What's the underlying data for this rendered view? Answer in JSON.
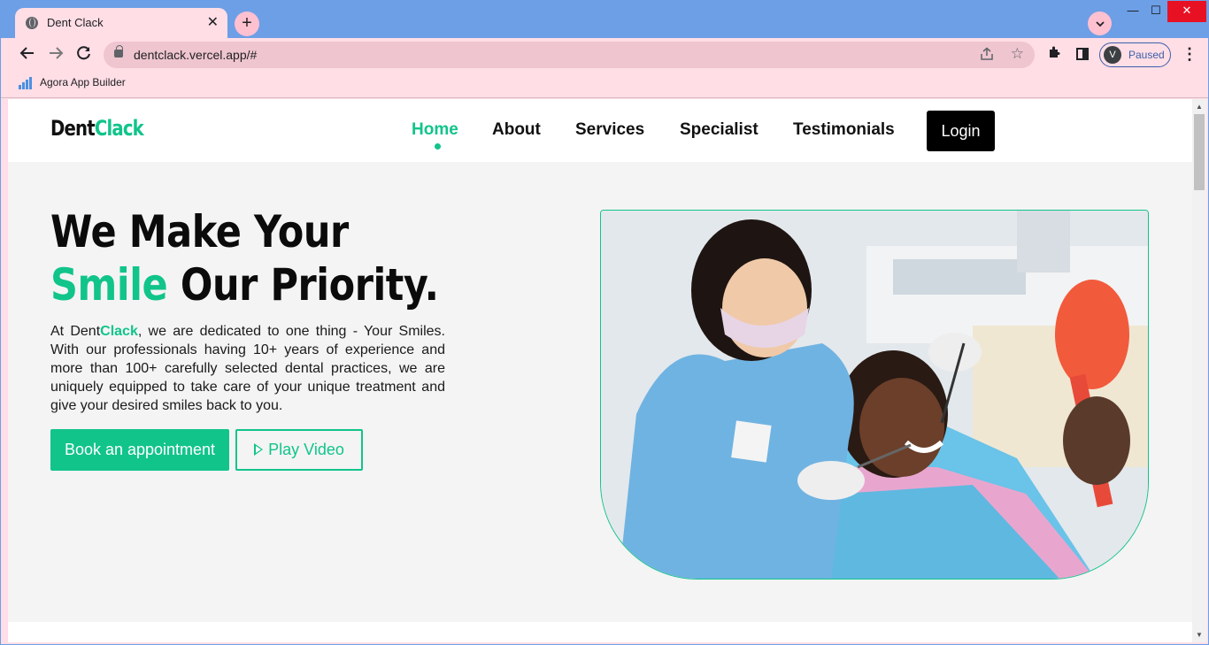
{
  "browser": {
    "tab_title": "Dent Clack",
    "tab_close": "✕",
    "new_tab": "+",
    "url": "dentclack.vercel.app/#",
    "profile_initial": "V",
    "profile_status": "Paused",
    "bookmark_label": "Agora App Builder",
    "window_min": "—",
    "window_max": "☐",
    "window_close": "✕"
  },
  "site": {
    "logo_part1": "Dent",
    "logo_part2": "Clack",
    "nav": [
      "Home",
      "About",
      "Services",
      "Specialist",
      "Testimonials"
    ],
    "active_nav": "Home",
    "login_label": "Login",
    "hero": {
      "headline_1": "We Make Your ",
      "headline_green": "Smile",
      "headline_2": " Our Priority.",
      "para_1": "At Dent",
      "para_green": "Clack",
      "para_2": ", we are dedicated to one thing - Your Smiles. With our professionals having 10+ years of experience and more than 100+ carefully selected dental practices, we are uniquely equipped to take care of your unique treatment and give your desired smiles back to you.",
      "book_label": "Book an appointment",
      "play_label": "Play Video"
    }
  },
  "colors": {
    "accent": "#11c48a",
    "browser_frame": "#6d9fe6",
    "browser_chrome": "#ffdee6"
  }
}
